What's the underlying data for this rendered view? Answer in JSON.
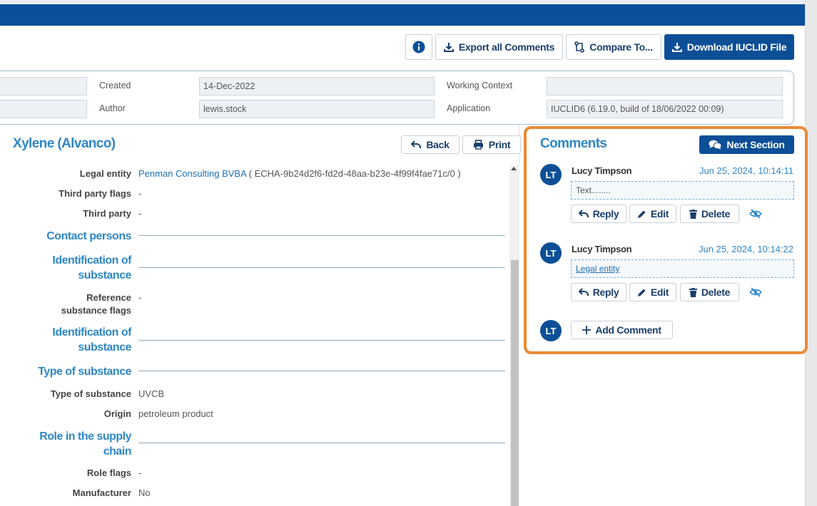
{
  "toolbar": {
    "info_icon": "info-circle-icon",
    "export_label": "Export all Comments",
    "compare_label": "Compare To...",
    "download_label": "Download IUCLID File"
  },
  "meta": {
    "created_label": "Created",
    "created_value": "14-Dec-2022",
    "author_label": "Author",
    "author_value": "lewis.stock",
    "working_context_label": "Working Context",
    "working_context_value": "",
    "application_label": "Application",
    "application_value": "IUCLID6 (6.19.0, build of 18/06/2022 00:09)"
  },
  "document": {
    "title": "Xylene (Alvanco)",
    "back_label": "Back",
    "print_label": "Print",
    "rows": {
      "legal_entity_label": "Legal entity",
      "legal_entity_link": "Penman Consulting BVBA",
      "legal_entity_id": " ( ECHA-9b24d2f6-fd2d-48aa-b23e-4f99f4fae71c/0 )",
      "third_party_flags_label": "Third party flags",
      "third_party_flags_value": "-",
      "third_party_label": "Third party",
      "third_party_value": "-",
      "contact_persons_head": "Contact persons",
      "ident_head_1": "Identification of substance",
      "ref_flags_label": "Reference substance flags",
      "ref_flags_value": "-",
      "ident_head_2": "Identification of substance",
      "type_head": "Type of substance",
      "type_label": "Type of substance",
      "type_value": "UVCB",
      "origin_label": "Origin",
      "origin_value": "petroleum product",
      "role_head": "Role in the supply chain",
      "role_flags_label": "Role flags",
      "role_flags_value": "-",
      "manufacturer_label": "Manufacturer",
      "manufacturer_value": "No"
    }
  },
  "comments": {
    "title": "Comments",
    "next_section_label": "Next Section",
    "items": [
      {
        "initials": "LT",
        "author": "Lucy Timpson",
        "time": "Jun 25, 2024, 10:14:11",
        "body": "Text........"
      },
      {
        "initials": "LT",
        "author": "Lucy Timpson",
        "time": "Jun 25, 2024, 10:14:22",
        "body": "Legal entity"
      }
    ],
    "reply_label": "Reply",
    "edit_label": "Edit",
    "delete_label": "Delete",
    "add_initials": "LT",
    "add_label": "Add Comment"
  },
  "colors": {
    "brand_blue": "#0d4f97",
    "heading_blue": "#2f87c5",
    "highlight_orange": "#e88b37"
  }
}
